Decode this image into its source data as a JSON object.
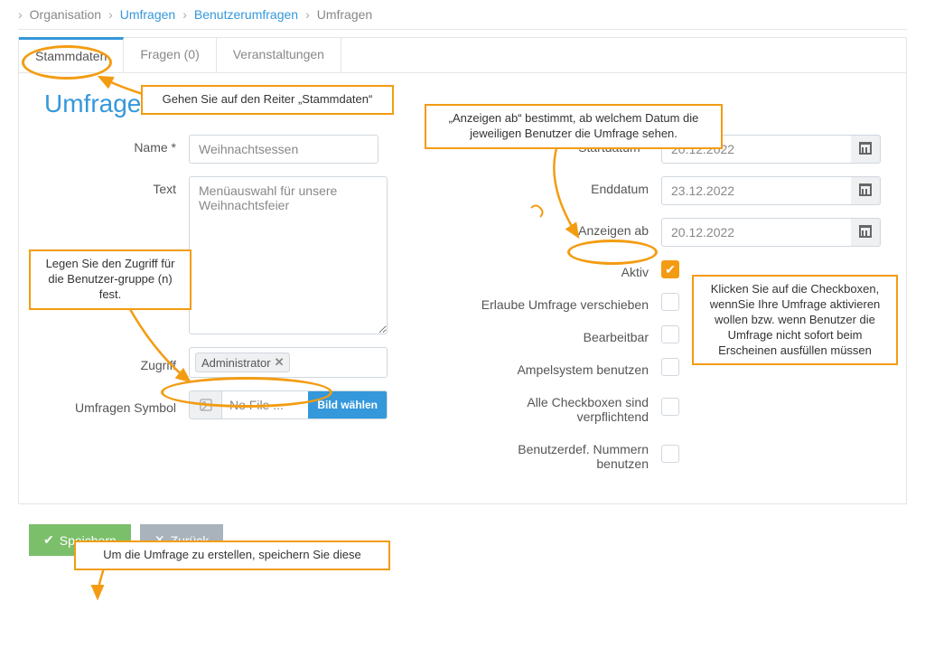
{
  "breadcrumb": {
    "org": "Organisation",
    "umfragen": "Umfragen",
    "benutzer": "Benutzerumfragen",
    "current": "Umfragen"
  },
  "tabs": {
    "stammdaten": "Stammdaten",
    "fragen": "Fragen (0)",
    "veranstaltungen": "Veranstaltungen"
  },
  "page_title": "Umfrage",
  "left": {
    "name_label": "Name *",
    "name_value": "Weihnachtsessen",
    "text_label": "Text",
    "text_value": "Menüauswahl für unsere Weihnachtsfeier",
    "zugriff_label": "Zugriff",
    "zugriff_tag": "Administrator",
    "symbol_label": "Umfragen Symbol",
    "no_file": "No File ...",
    "file_button": "Bild wählen"
  },
  "right": {
    "start_label": "Startdatum *",
    "start_value": "20.12.2022",
    "end_label": "Enddatum",
    "end_value": "23.12.2022",
    "anzeigen_label": "Anzeigen ab",
    "anzeigen_value": "20.12.2022",
    "aktiv_label": "Aktiv",
    "verschieben_label": "Erlaube Umfrage verschieben",
    "bearbeitbar_label": "Bearbeitbar",
    "ampel_label": "Ampelsystem benutzen",
    "pflicht_label": "Alle Checkboxen sind verpflichtend",
    "nummern_label": "Benutzerdef. Nummern benutzen"
  },
  "footer": {
    "save": "Speichern",
    "back": "Zurück"
  },
  "callouts": {
    "tab_hint": "Gehen Sie auf den Reiter „Stammdaten“",
    "zugriff_hint": "Legen Sie den Zugriff für die Benutzer-gruppe (n) fest.",
    "anzeigen_hint": "„Anzeigen ab“ bestimmt, ab welchem Datum die jeweiligen Benutzer die Umfrage sehen.",
    "checkbox_hint": "Klicken Sie auf die Checkboxen, wennSie Ihre Umfrage aktivieren wollen bzw. wenn Benutzer die Umfrage nicht sofort beim Erscheinen ausfüllen müssen",
    "save_hint": "Um die Umfrage zu erstellen, speichern Sie diese"
  }
}
